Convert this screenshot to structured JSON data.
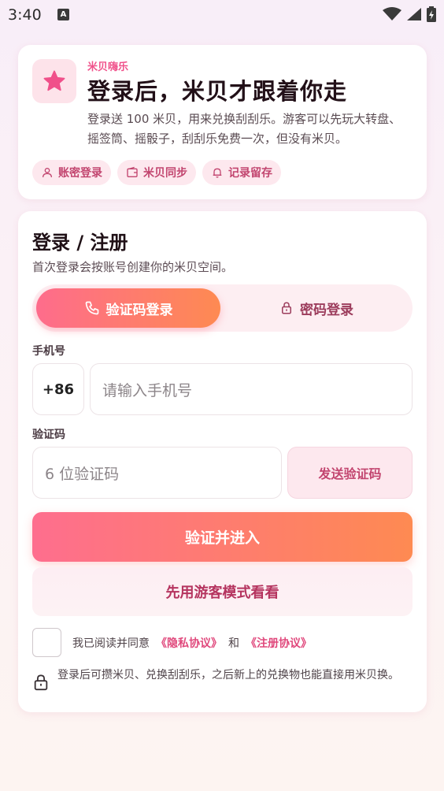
{
  "status_bar": {
    "time": "3:40",
    "notification_glyph": "A"
  },
  "intro": {
    "eyebrow": "米贝嗨乐",
    "title": "登录后，米贝才跟着你走",
    "description": "登录送 100 米贝，用来兑换刮刮乐。游客可以先玩大转盘、摇签筒、摇骰子，刮刮乐免费一次，但没有米贝。",
    "chips": [
      {
        "label": "账密登录",
        "icon": "user-icon"
      },
      {
        "label": "米贝同步",
        "icon": "wallet-icon"
      },
      {
        "label": "记录留存",
        "icon": "bell-icon"
      }
    ]
  },
  "login": {
    "title": "登录 / 注册",
    "subtitle": "首次登录会按账号创建你的米贝空间。",
    "tabs": [
      {
        "label": "验证码登录",
        "icon": "phone-icon",
        "active": true
      },
      {
        "label": "密码登录",
        "icon": "lock-icon",
        "active": false
      }
    ],
    "phone_label": "手机号",
    "country_code": "+86",
    "phone_placeholder": "请输入手机号",
    "code_label": "验证码",
    "code_placeholder": "6 位验证码",
    "send_code_label": "发送验证码",
    "submit_label": "验证并进入",
    "guest_label": "先用游客模式看看",
    "agree_prefix": "我已阅读并同意",
    "privacy_link": "《隐私协议》",
    "agree_and": "和",
    "register_link": "《注册协议》",
    "note": "登录后可攒米贝、兑换刮刮乐，之后新上的兑换物也能直接用米贝换。"
  },
  "colors": {
    "accent_pink": "#f0508a",
    "gradient_start": "#fe6c8c",
    "gradient_end": "#fe8a52",
    "chip_bg": "#fde8ee",
    "chip_text": "#c2456f"
  }
}
